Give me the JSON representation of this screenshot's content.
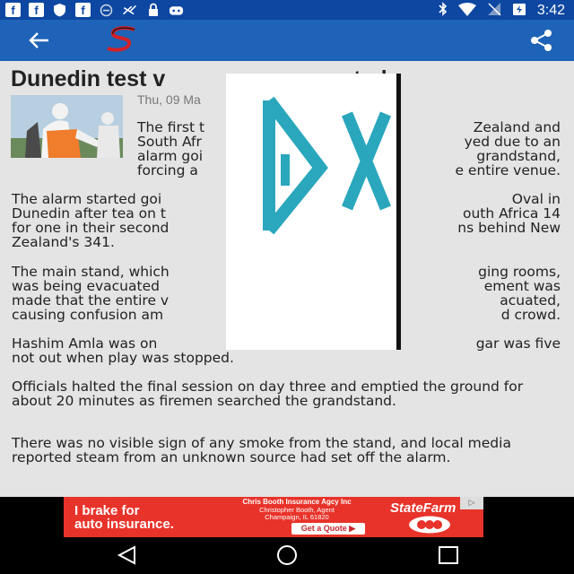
{
  "status_bar": {
    "left_icons": [
      "facebook-icon",
      "facebook-icon",
      "shield-icon",
      "facebook-icon",
      "info-icon",
      "no-signal-icon",
      "lock-icon",
      "game-icon"
    ],
    "right_icons": [
      "bluetooth-icon",
      "wifi-icon",
      "no-sim-icon",
      "battery-icon"
    ],
    "time": "3:42"
  },
  "app_bar": {
    "background": "#1e63b7",
    "icons": [
      "back-arrow-icon",
      "supersport-logo",
      "share-icon"
    ]
  },
  "article": {
    "title": "Dunedin test v",
    "title_end": "ated",
    "date": "Thu, 09 Ma",
    "lead_lines": [
      "The first t",
      "Zealand and",
      "South Afr",
      "yed due to an",
      "alarm goi",
      "grandstand,",
      "forcing a",
      "e entire venue."
    ],
    "paragraphs": [
      [
        "The alarm started goi",
        "Oval in",
        "Dunedin after tea on t",
        "outh Africa 14",
        "for one in their second",
        "ns behind New",
        "Zealand's 341."
      ],
      [
        "The main stand, which",
        "ging rooms,",
        "was being evacuated",
        "ement was",
        "made that the entire v",
        "acuated,",
        "causing confusion am",
        "d crowd."
      ],
      [
        "Hashim Amla was on",
        "gar was five",
        "not out when play was stopped."
      ],
      [
        "Officials halted the final session on day three and emptied the ground for about 20 minutes as firemen searched the grandstand."
      ],
      [
        "There was no visible sign of any smoke from the stand, and local media reported steam from an unknown source had set off the alarm."
      ]
    ]
  },
  "overlay": {
    "glyphs": "DX",
    "color": "#2aa7bd"
  },
  "ad": {
    "background": "#e8332a",
    "line1": "I brake for",
    "line2": "auto insurance.",
    "agent_name": "Chris Booth Insurance Agcy Inc",
    "agent_title": "Christopher Booth, Agent",
    "agent_city": "Champaign, IL 61820",
    "button": "Get a Quote ▶",
    "brand": "StateFarm",
    "choice_icon": "ad-choices-icon"
  },
  "nav_bar": {
    "icons": [
      "back-triangle-icon",
      "home-circle-icon",
      "recents-square-icon"
    ]
  }
}
